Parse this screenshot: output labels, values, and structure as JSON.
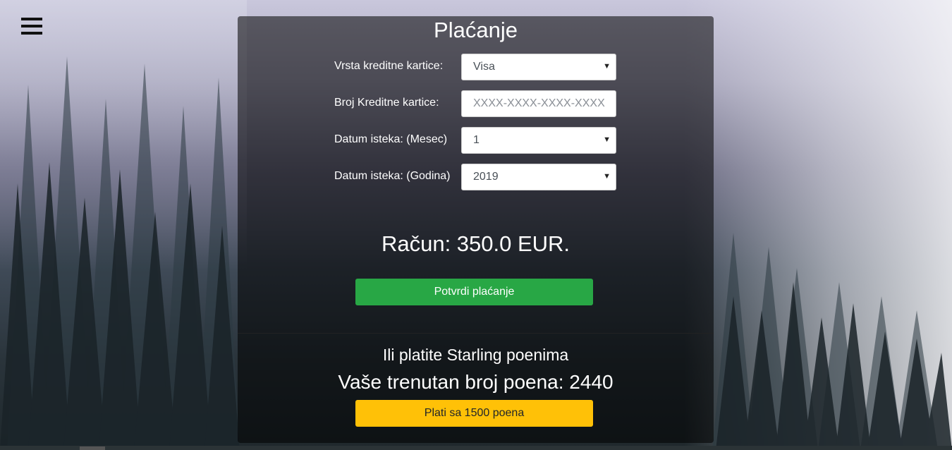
{
  "page": {
    "title": "Plaćanje"
  },
  "form": {
    "card_type": {
      "label": "Vrsta kreditne kartice:",
      "value": "Visa"
    },
    "card_number": {
      "label": "Broj Kreditne kartice:",
      "placeholder": "XXXX-XXXX-XXXX-XXXX"
    },
    "exp_month": {
      "label": "Datum isteka: (Mesec)",
      "value": "1"
    },
    "exp_year": {
      "label": "Datum isteka: (Godina)",
      "value": "2019"
    }
  },
  "bill": {
    "text": "Račun: 350.0 EUR."
  },
  "buttons": {
    "confirm": "Potvrdi plaćanje",
    "pay_points": "Plati sa 1500 poena"
  },
  "points": {
    "alt_title": "Ili platite Starling poenima",
    "balance": "Vaše trenutan broj poena: 2440"
  },
  "icons": {
    "menu": "hamburger-menu-icon",
    "dropdown": "caret-down-icon"
  },
  "colors": {
    "confirm_button": "#28a745",
    "points_button": "#ffc107",
    "panel_bg": "rgba(0,0,0,0.55)"
  }
}
